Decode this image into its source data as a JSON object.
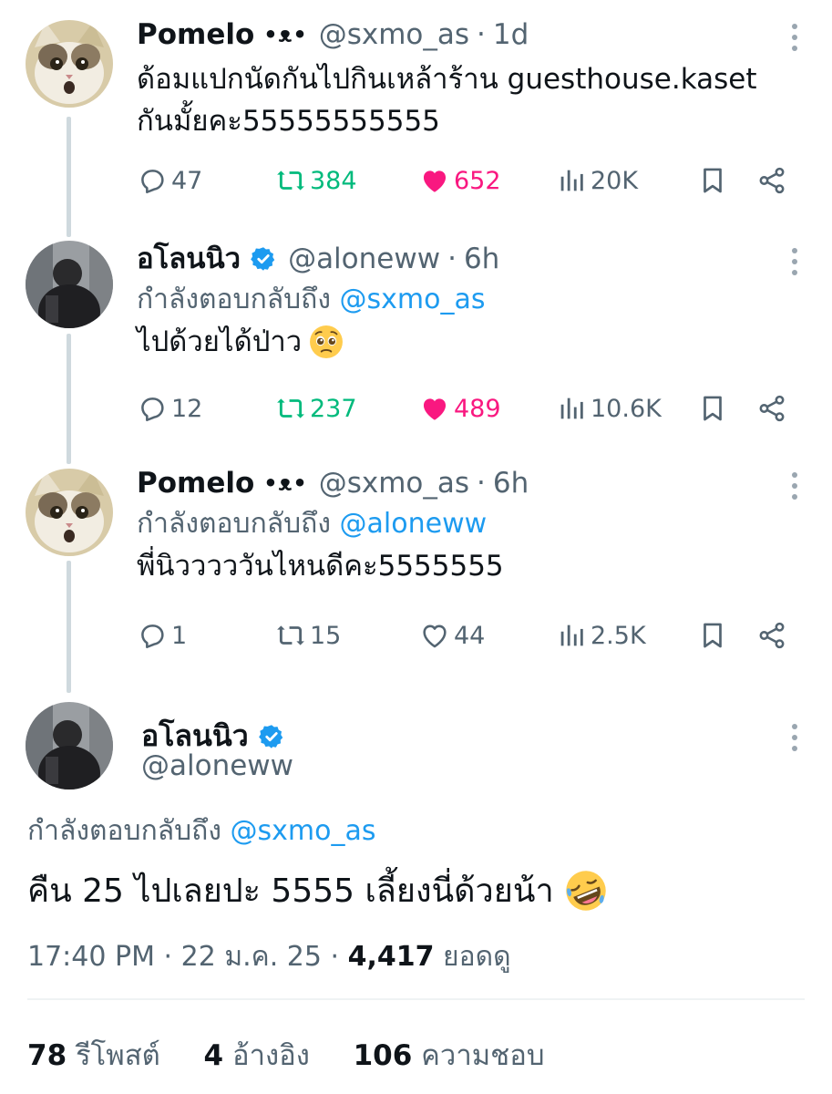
{
  "thread": [
    {
      "name": "Pomelo",
      "name_deco": "•ᴥ•",
      "handle": "@sxmo_as",
      "time": "1d",
      "reply_prefix": "",
      "reply_mention": "",
      "text_line1": "ด้อมแปกนัดกันไปกินเหล้าร้าน guesthouse.kaset",
      "text_line2": "กันมั้ยคะ55555555555",
      "emoji": "",
      "replies": "47",
      "retweets": "384",
      "likes": "652",
      "views": "20K",
      "retweeted": true,
      "liked": true
    },
    {
      "name": "อโลนนิว",
      "handle": "@aloneww",
      "time": "6h",
      "reply_prefix": "กำลังตอบกลับถึง",
      "reply_mention": "@sxmo_as",
      "text_line1": "ไปด้วยได้ป่าว",
      "emoji": "pleading-face",
      "replies": "12",
      "retweets": "237",
      "likes": "489",
      "views": "10.6K",
      "retweeted": true,
      "liked": true
    },
    {
      "name": "Pomelo",
      "name_deco": "•ᴥ•",
      "handle": "@sxmo_as",
      "time": "6h",
      "reply_prefix": "กำลังตอบกลับถึง",
      "reply_mention": "@aloneww",
      "text_line1": "พี่นิวววววันไหนดีคะ5555555",
      "emoji": "",
      "replies": "1",
      "retweets": "15",
      "likes": "44",
      "views": "2.5K",
      "retweeted": false,
      "liked": false
    }
  ],
  "main": {
    "name": "อโลนนิว",
    "handle": "@aloneww",
    "reply_prefix": "กำลังตอบกลับถึง",
    "reply_mention": "@sxmo_as",
    "text": "คืน 25 ไปเลยปะ 5555 เลี้ยงนี่ด้วยน้า",
    "emoji": "rofl-face",
    "time": "17:40 PM",
    "date": "22 ม.ค. 25",
    "views_count": "4,417",
    "views_label": "ยอดดู",
    "retweets_count": "78",
    "retweets_label": "รีโพสต์",
    "quotes_count": "4",
    "quotes_label": "อ้างอิง",
    "likes_count": "106",
    "likes_label": "ความชอบ"
  },
  "colors": {
    "accent": "#1d9bf0",
    "retweet": "#00ba7c",
    "like": "#f91880",
    "muted": "#536471",
    "thread_line": "#cfd9de"
  },
  "separator": "·"
}
